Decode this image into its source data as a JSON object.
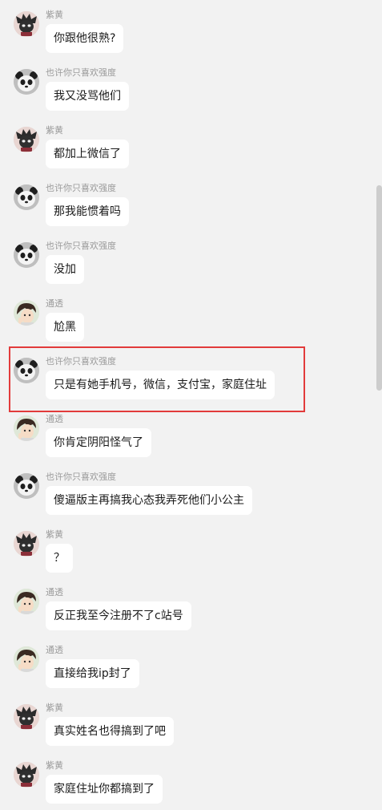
{
  "users": {
    "zihuang": "紫黄",
    "yexu": "也许你只喜欢强度",
    "tongtou": "通透"
  },
  "avatars": {
    "zihuang": "dark-cartoon-avatar-icon",
    "yexu": "panda-avatar-icon",
    "tongtou": "anime-boy-avatar-icon"
  },
  "messages": [
    {
      "sender": "紫黄",
      "text": "你跟他很熟?"
    },
    {
      "sender": "也许你只喜欢强度",
      "text": "我又没骂他们"
    },
    {
      "sender": "紫黄",
      "text": "都加上微信了"
    },
    {
      "sender": "也许你只喜欢强度",
      "text": "那我能惯着吗"
    },
    {
      "sender": "也许你只喜欢强度",
      "text": "没加"
    },
    {
      "sender": "通透",
      "text": "尬黑"
    },
    {
      "sender": "也许你只喜欢强度",
      "text": "只是有她手机号，微信，支付宝，家庭住址"
    },
    {
      "sender": "通透",
      "text": "你肯定阴阳怪气了"
    },
    {
      "sender": "也许你只喜欢强度",
      "text": "傻逼版主再搞我心态我弄死他们小公主"
    },
    {
      "sender": "紫黄",
      "text": "？"
    },
    {
      "sender": "通透",
      "text": "反正我至今注册不了c站号"
    },
    {
      "sender": "通透",
      "text": "直接给我ip封了"
    },
    {
      "sender": "紫黄",
      "text": "真实姓名也得搞到了吧"
    },
    {
      "sender": "紫黄",
      "text": "家庭住址你都搞到了"
    }
  ],
  "colors": {
    "background": "#f2f2f2",
    "bubble": "#ffffff",
    "sender_name": "#9a9a9a",
    "highlight_border": "#e23b3b"
  }
}
